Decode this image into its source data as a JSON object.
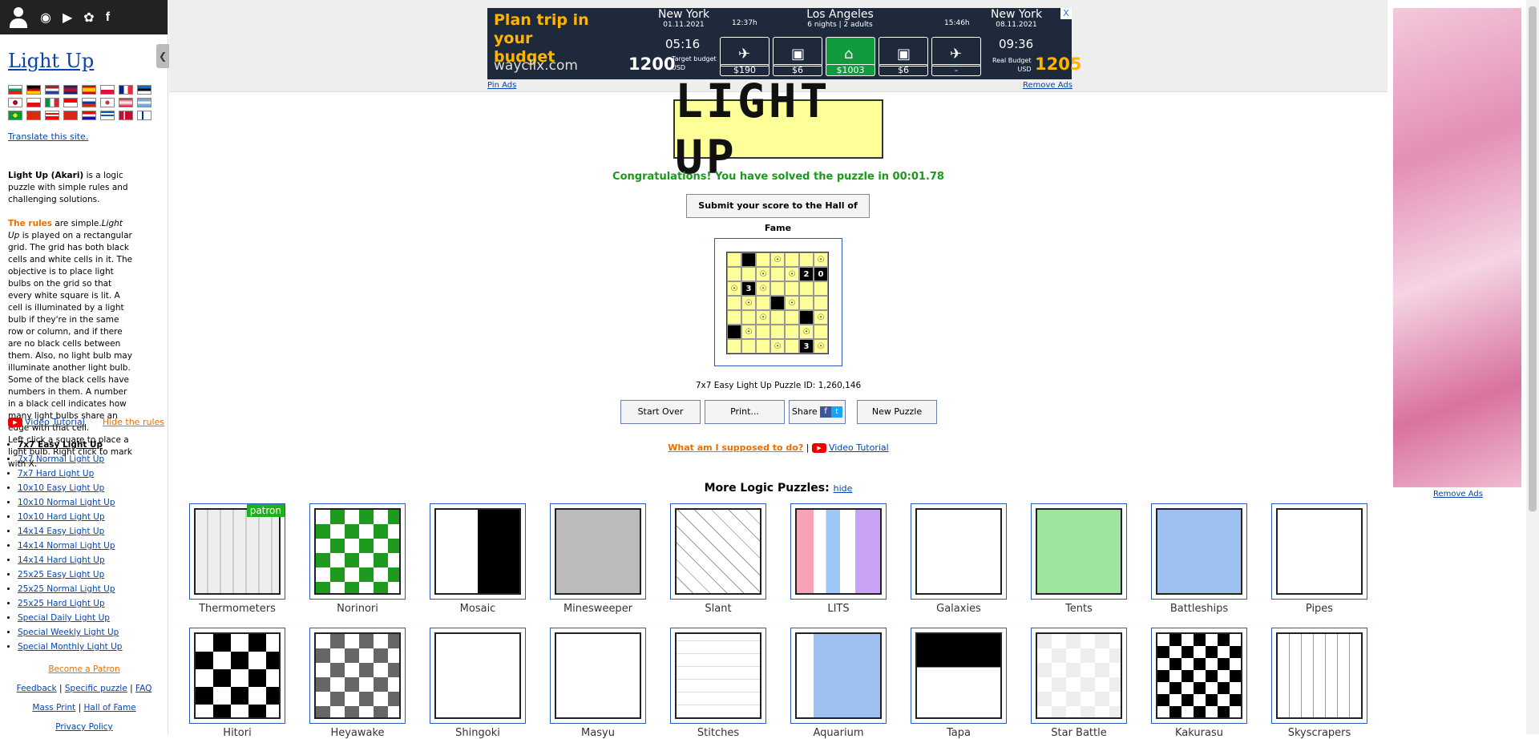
{
  "sidebar": {
    "site_title": "Light Up",
    "translate": "Translate this site.",
    "intro_bold": "Light Up (Akari)",
    "intro_rest": " is a logic puzzle with simple rules and challenging solutions.",
    "rules_lead": "The rules",
    "rules_text_a": " are simple.",
    "rules_italic": "Light Up",
    "rules_text_b": " is played on a rectangular grid. The grid has both black cells and white cells in it. The objective is to place light bulbs on the grid so that every white square is lit. A cell is illuminated by a light bulb if they're in the same row or column, and if there are no black cells between them. Also, no light bulb may illuminate another light bulb.",
    "rules_text_c": "Some of the black cells have numbers in them. A number in a black cell indicates how many light bulbs share an edge with that cell.",
    "rules_text_d": "Left click a square to place a light bulb. Right click to mark with X.",
    "video_tutorial": "Video Tutorial",
    "hide_rules": "Hide the rules",
    "puzzles": [
      "7x7 Easy Light Up",
      "7x7 Normal Light Up",
      "7x7 Hard Light Up",
      "10x10 Easy Light Up",
      "10x10 Normal Light Up",
      "10x10 Hard Light Up",
      "14x14 Easy Light Up",
      "14x14 Normal Light Up",
      "14x14 Hard Light Up",
      "25x25 Easy Light Up",
      "25x25 Normal Light Up",
      "25x25 Hard Light Up",
      "Special Daily Light Up",
      "Special Weekly Light Up",
      "Special Monthly Light Up"
    ],
    "become_patron": "Become a Patron",
    "feedback": "Feedback",
    "specific_puzzle": "Specific puzzle",
    "faq": "FAQ",
    "mass_print": "Mass Print",
    "hall_of_fame": "Hall of Fame",
    "privacy": "Privacy Policy"
  },
  "ad": {
    "plan": "Plan trip in your budget",
    "brand": "wayclix.com",
    "target_budget": "1200",
    "target_label": "Target budget",
    "usd": "USD",
    "from_city": "New York",
    "from_date": "01.11.2021",
    "from_time": "05:16",
    "flight1": "12:37h",
    "dest_city": "Los Angeles",
    "stay": "6 nights | 2 adults",
    "flight2": "15:46h",
    "to_city": "New York",
    "to_date": "08.11.2021",
    "to_time": "09:36",
    "prices": [
      "$190",
      "$6",
      "$1003",
      "$6",
      "-"
    ],
    "real_label": "Real Budget",
    "real_budget": "1205",
    "close": "X",
    "pin_ads": "Pin Ads",
    "remove_ads": "Remove Ads"
  },
  "main": {
    "logo_text": "LIGHT UP",
    "congrats": "Congratulations! You have solved the puzzle in 00:01.78",
    "submit": "Submit your score to the Hall of Fame",
    "puzzle_id": "7x7 Easy Light Up Puzzle ID: 1,260,146",
    "start_over": "Start Over",
    "print": "Print...",
    "share": "Share",
    "new_puzzle": "New Puzzle",
    "what_am_i": "What am I supposed to do?",
    "video_tutorial": "Video Tutorial",
    "more_title": "More Logic Puzzles:",
    "hide": "hide",
    "patron": "patron",
    "board": [
      [
        "",
        "B",
        "",
        "L",
        "",
        "",
        "L"
      ],
      [
        "",
        "",
        "L",
        "",
        "L",
        "2",
        "0"
      ],
      [
        "L",
        "3",
        "L",
        "",
        "",
        "",
        ""
      ],
      [
        "",
        "L",
        "",
        "B",
        "L",
        "",
        ""
      ],
      [
        "",
        "",
        "L",
        "",
        "",
        "B",
        "L"
      ],
      [
        "B",
        "L",
        "",
        "",
        "",
        "L",
        ""
      ],
      [
        "",
        "",
        "",
        "L",
        "",
        "3",
        "L"
      ]
    ],
    "puzzles_row1": [
      "Thermometers",
      "Norinori",
      "Mosaic",
      "Minesweeper",
      "Slant",
      "LITS",
      "Galaxies",
      "Tents",
      "Battleships",
      "Pipes"
    ],
    "puzzles_row2": [
      "Hitori",
      "Heyawake",
      "Shingoki",
      "Masyu",
      "Stitches",
      "Aquarium",
      "Tapa",
      "Star Battle",
      "Kakurasu",
      "Skyscrapers"
    ]
  },
  "right_ad": {
    "remove_ads": "Remove Ads"
  },
  "colors": {
    "lit": "#ffff99",
    "congrats": "#1a9a1a",
    "link": "#0645ad",
    "accent": "#e86f00"
  }
}
